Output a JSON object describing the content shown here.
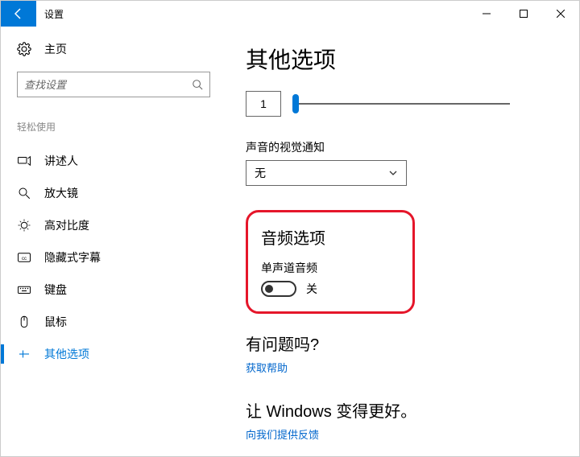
{
  "window": {
    "title": "设置"
  },
  "sidebar": {
    "home": "主页",
    "search_placeholder": "查找设置",
    "section": "轻松使用",
    "items": [
      {
        "label": "讲述人"
      },
      {
        "label": "放大镜"
      },
      {
        "label": "高对比度"
      },
      {
        "label": "隐藏式字幕"
      },
      {
        "label": "键盘"
      },
      {
        "label": "鼠标"
      },
      {
        "label": "其他选项"
      }
    ]
  },
  "main": {
    "title": "其他选项",
    "slider_value": "1",
    "visual_notif_label": "声音的视觉通知",
    "visual_notif_value": "无",
    "audio_section": "音频选项",
    "mono_label": "单声道音频",
    "mono_state": "关",
    "help_h": "有问题吗?",
    "help_link": "获取帮助",
    "improve_h": "让 Windows 变得更好。",
    "feedback_link": "向我们提供反馈"
  }
}
